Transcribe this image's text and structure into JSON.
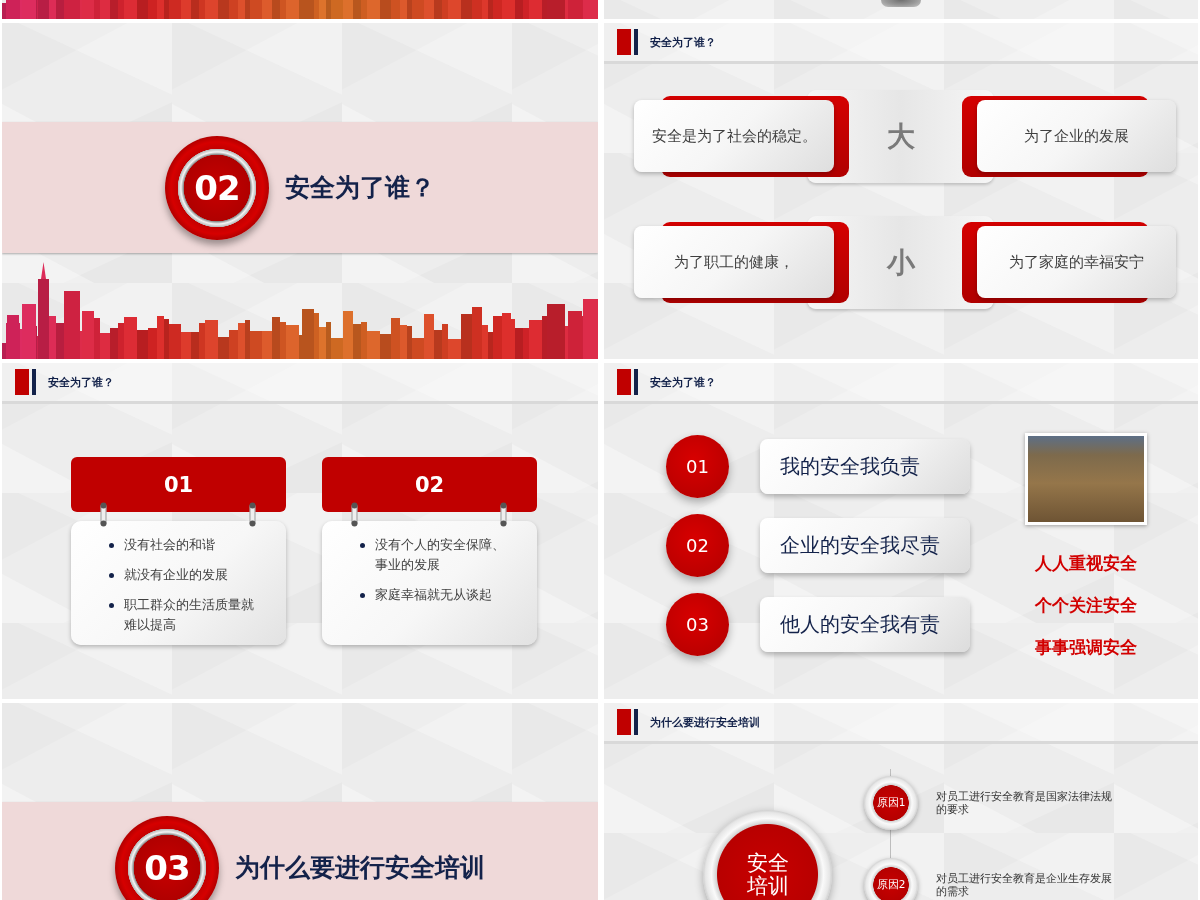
{
  "slides": [
    {
      "kind": "skyline-strip"
    },
    {
      "kind": "shadow-strip"
    },
    {
      "kind": "section",
      "number": "02",
      "title": "安全为了谁？"
    },
    {
      "kind": "contrast-cards",
      "header": "安全为了谁？",
      "rows": [
        {
          "left": "安全是为了社会的稳定。",
          "center": "大",
          "right": "为了企业的发展"
        },
        {
          "left": "为了职工的健康，",
          "center": "小",
          "right": "为了家庭的幸福安宁"
        }
      ]
    },
    {
      "kind": "hanging-cards",
      "header": "安全为了谁？",
      "cards": [
        {
          "number": "01",
          "bullets": [
            "没有社会的和谐",
            "就没有企业的发展",
            "职工群众的生活质量就难以提高"
          ]
        },
        {
          "number": "02",
          "bullets": [
            "没有个人的安全保障、事业的发展",
            "家庭幸福就无从谈起"
          ]
        }
      ]
    },
    {
      "kind": "numbered-list",
      "header": "安全为了谁？",
      "items": [
        {
          "number": "01",
          "text": "我的安全我负责"
        },
        {
          "number": "02",
          "text": "企业的安全我尽责"
        },
        {
          "number": "03",
          "text": "他人的安全我有责"
        }
      ],
      "slogans": [
        "人人重视安全",
        "个个关注安全",
        "事事强调安全"
      ]
    },
    {
      "kind": "section",
      "number": "03",
      "title": "为什么要进行安全培训"
    },
    {
      "kind": "reasons",
      "header": "为什么要进行安全培训",
      "center": "安全培训",
      "reasons": [
        {
          "label": "原因1",
          "text": "对员工进行安全教育是国家法律法规的要求"
        },
        {
          "label": "原因2",
          "text": "对员工进行安全教育是企业生存发展的需求"
        }
      ]
    }
  ]
}
